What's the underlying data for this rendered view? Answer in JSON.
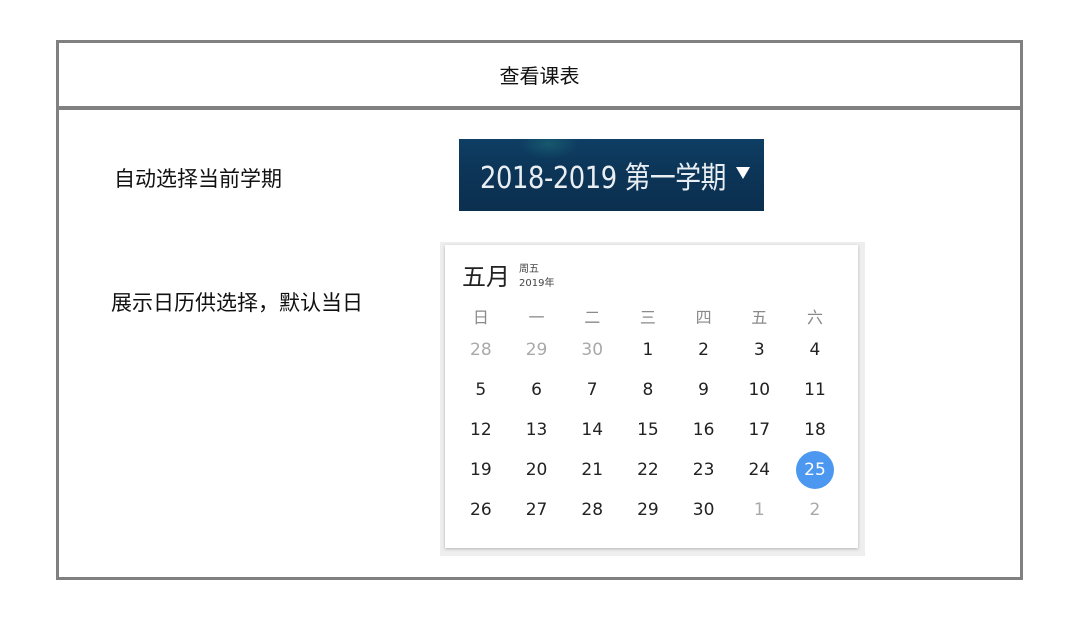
{
  "header": {
    "title": "查看课表"
  },
  "labels": {
    "auto_select": "自动选择当前学期",
    "show_calendar": "展示日历供选择，默认当日"
  },
  "semester_selector": {
    "value": "2018-2019 第一学期",
    "icon": "caret-down-icon"
  },
  "calendar": {
    "month": "五月",
    "weekday": "周五",
    "year": "2019年",
    "weekdays": [
      "日",
      "一",
      "二",
      "三",
      "四",
      "五",
      "六"
    ],
    "days": [
      {
        "label": "28",
        "muted": true
      },
      {
        "label": "29",
        "muted": true
      },
      {
        "label": "30",
        "muted": true
      },
      {
        "label": "1"
      },
      {
        "label": "2"
      },
      {
        "label": "3"
      },
      {
        "label": "4"
      },
      {
        "label": "5"
      },
      {
        "label": "6"
      },
      {
        "label": "7"
      },
      {
        "label": "8"
      },
      {
        "label": "9"
      },
      {
        "label": "10"
      },
      {
        "label": "11"
      },
      {
        "label": "12"
      },
      {
        "label": "13"
      },
      {
        "label": "14"
      },
      {
        "label": "15"
      },
      {
        "label": "16"
      },
      {
        "label": "17"
      },
      {
        "label": "18"
      },
      {
        "label": "19"
      },
      {
        "label": "20"
      },
      {
        "label": "21"
      },
      {
        "label": "22"
      },
      {
        "label": "23"
      },
      {
        "label": "24"
      },
      {
        "label": "25",
        "selected": true
      },
      {
        "label": "26"
      },
      {
        "label": "27"
      },
      {
        "label": "28"
      },
      {
        "label": "29"
      },
      {
        "label": "30"
      },
      {
        "label": "1",
        "muted": true
      },
      {
        "label": "2",
        "muted": true
      }
    ],
    "selected_color": "#4c97f0"
  }
}
